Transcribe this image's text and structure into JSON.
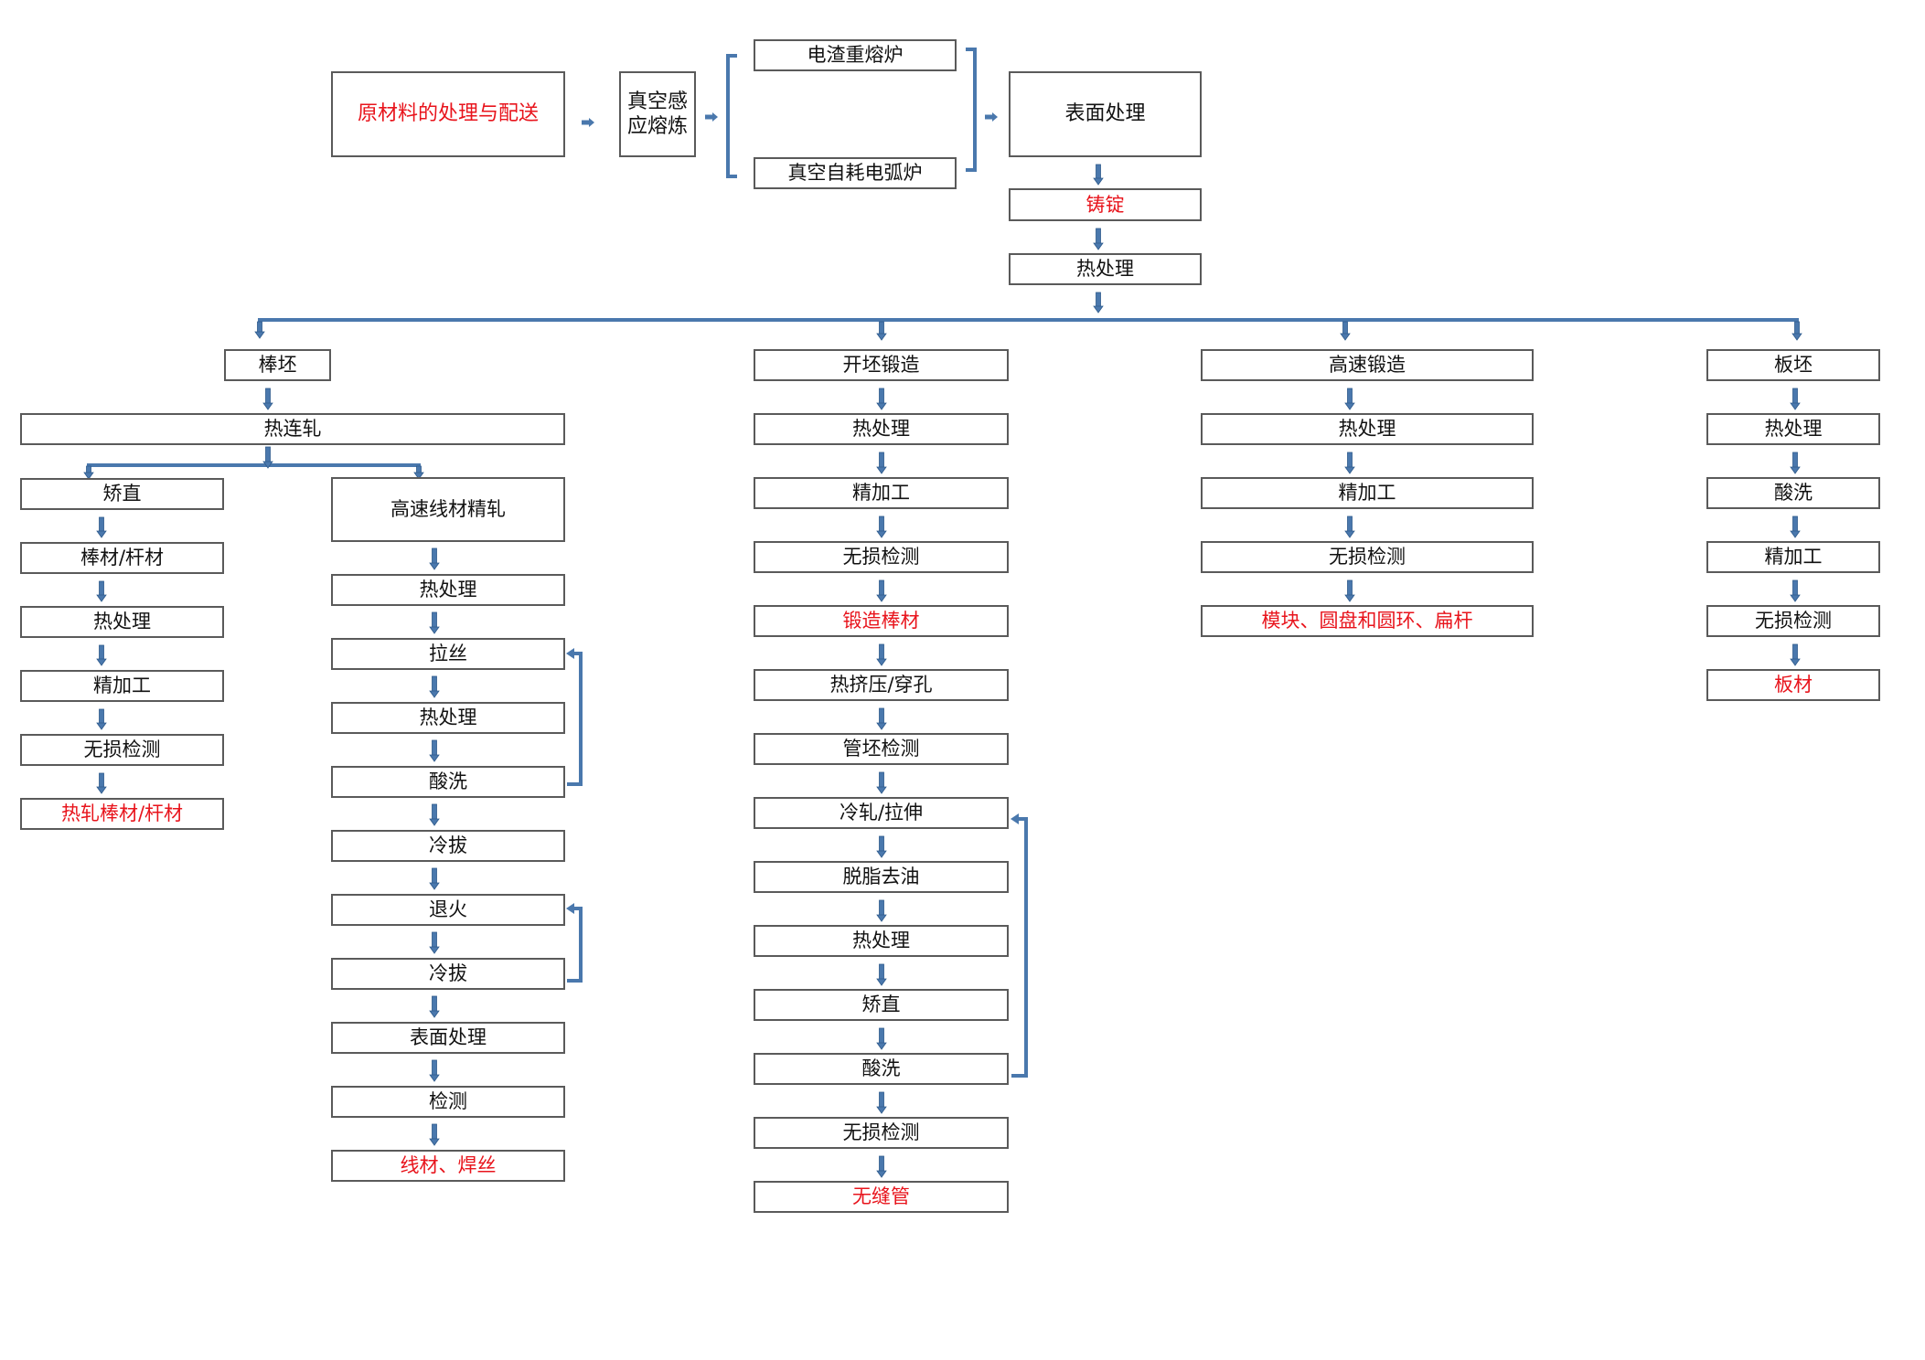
{
  "colors": {
    "text": "#111111",
    "highlight": "#e8141c",
    "connector": "#4a78ad",
    "border": "#5a5a5a"
  },
  "top": {
    "raw_material": "原材料的处理与配送",
    "vim": "真空感应熔炼",
    "esr": "电渣重熔炉",
    "var": "真空自耗电弧炉",
    "surface": "表面处理",
    "ingot": "铸锭",
    "heat": "热处理"
  },
  "branch_bar": {
    "root": "棒坯",
    "hot_roll": "热连轧",
    "straight_path": [
      "矫直",
      "棒材/杆材",
      "热处理",
      "精加工",
      "无损检测",
      "热轧棒材/杆材"
    ],
    "wire_path": [
      "高速线材精轧",
      "热处理",
      "拉丝",
      "热处理",
      "酸洗",
      "冷拔",
      "退火",
      "冷拔",
      "表面处理",
      "检测",
      "线材、焊丝"
    ]
  },
  "branch_forge": {
    "steps": [
      "开坯锻造",
      "热处理",
      "精加工",
      "无损检测",
      "锻造棒材",
      "热挤压/穿孔",
      "管坯检测",
      "冷轧/拉伸",
      "脱脂去油",
      "热处理",
      "矫直",
      "酸洗",
      "无损检测",
      "无缝管"
    ]
  },
  "branch_highspeed": {
    "steps": [
      "高速锻造",
      "热处理",
      "精加工",
      "无损检测",
      "模块、圆盘和圆环、扁杆"
    ]
  },
  "branch_plate": {
    "steps": [
      "板坯",
      "热处理",
      "酸洗",
      "精加工",
      "无损检测",
      "板材"
    ]
  },
  "final_products": [
    "热轧棒材/杆材",
    "线材、焊丝",
    "锻造棒材",
    "无缝管",
    "模块、圆盘和圆环、扁杆",
    "板材",
    "铸锭",
    "原材料的处理与配送"
  ]
}
